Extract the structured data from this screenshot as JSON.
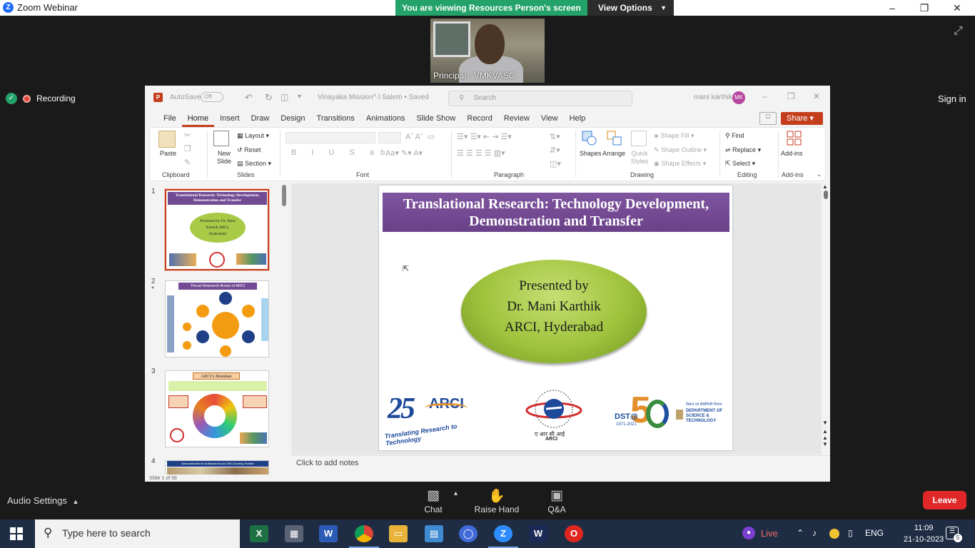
{
  "zoom": {
    "window_title": "Zoom Webinar",
    "banner_text": "You are viewing Resources Person's screen",
    "view_options_label": "View Options",
    "participant_name": "Principal - VMKVASC",
    "recording_label": "Recording",
    "sign_in_label": "Sign in",
    "audio_settings_label": "Audio Settings",
    "controls": {
      "chat": "Chat",
      "raise_hand": "Raise Hand",
      "qa": "Q&A"
    },
    "leave_label": "Leave"
  },
  "ppt": {
    "autosave_label": "AutoSave",
    "autosave_state": "Off",
    "doc_title": "Vinayaka Mission^.l Salem  •  Saved",
    "search_placeholder": "Search",
    "user_name": "mani karthik",
    "user_initials": "MK",
    "share_label": "Share",
    "tabs": [
      "File",
      "Home",
      "Insert",
      "Draw",
      "Design",
      "Transitions",
      "Animations",
      "Slide Show",
      "Record",
      "Review",
      "View",
      "Help"
    ],
    "active_tab": "Home",
    "ribbon": {
      "paste": "Paste",
      "clipboard": "Clipboard",
      "new_slide": "New Slide",
      "layout": "Layout",
      "reset": "Reset",
      "section": "Section",
      "slides": "Slides",
      "font": "Font",
      "paragraph": "Paragraph",
      "shapes": "Shapes",
      "arrange": "Arrange",
      "quick_styles": "Quick Styles",
      "shape_fill": "Shape Fill",
      "shape_outline": "Shape Outline",
      "shape_effects": "Shape Effects",
      "drawing": "Drawing",
      "find": "Find",
      "replace": "Replace",
      "select": "Select",
      "editing": "Editing",
      "addins": "Add-ins",
      "addins_group": "Add-ins"
    },
    "thumbnails": [
      {
        "num": "1",
        "title": "Translational Research: Technology Development, Demonstration and Transfer",
        "oval": "Presented by Dr. Mani Karthik ARCI, Hyderabad"
      },
      {
        "num": "2",
        "title": "Thrust Research Areas of ARCI"
      },
      {
        "num": "3",
        "title": "ARCI's Mandate"
      },
      {
        "num": "4",
        "title": "Nanomaterials for Antibacterial and Self Cleaning Textiles"
      }
    ],
    "slide": {
      "title_line1": "Translational Research: Technology Development,",
      "title_line2": "Demonstration and Transfer",
      "oval_line1": "Presented by",
      "oval_line2": "Dr. Mani Karthik",
      "oval_line3": "ARCI, Hyderabad",
      "logo1_text": "ARCI",
      "logo1_number": "25",
      "logo1_tagline": "Translating Research to Technology",
      "logo2_text": "ए आर सी आई",
      "logo2_sub": "ARCI",
      "logo3_brand": "DST@",
      "logo3_years": "1971-2021",
      "logo3_dept": "DEPARTMENT OF SCIENCE & TECHNOLOGY",
      "logo3_hindi": "विज्ञान एवं प्रौद्योगिकी विभाग"
    },
    "notes_placeholder": "Click to add notes",
    "status_slide": "Slide 1 of 56"
  },
  "taskbar": {
    "search_placeholder": "Type here to search",
    "live_label": "Live",
    "language": "ENG",
    "time": "11:09",
    "date": "21-10-2023",
    "notification_count": "5"
  }
}
